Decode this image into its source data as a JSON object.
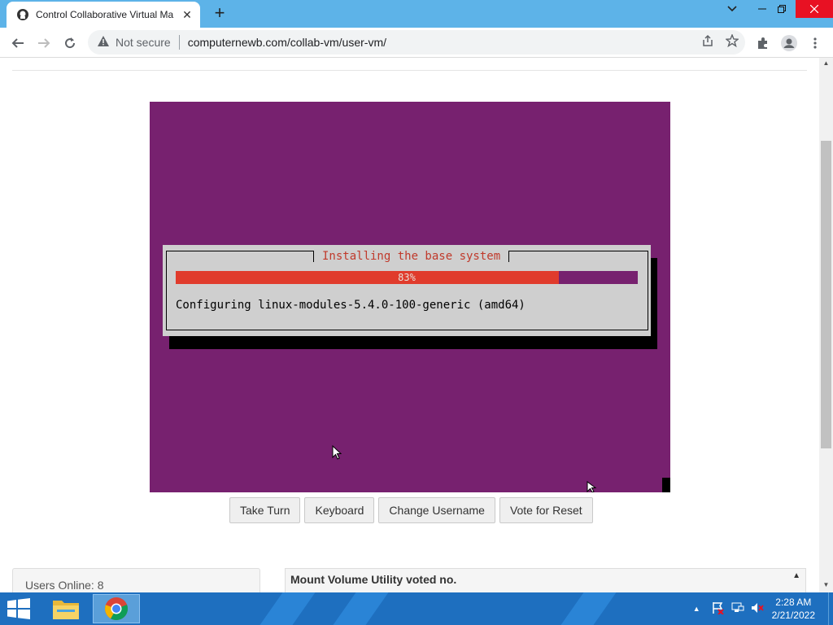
{
  "browser": {
    "tab_title": "Control Collaborative Virtual Ma",
    "tab_close": "✕",
    "new_tab": "+",
    "security_label": "Not secure",
    "url": "computernewb.com/collab-vm/user-vm/"
  },
  "vm": {
    "dialog_title": "Installing the base system",
    "progress_label": "83%",
    "progress_fraction": 0.83,
    "status_message": "Configuring linux-modules-5.4.0-100-generic (amd64)"
  },
  "controls": {
    "take_turn": "Take Turn",
    "keyboard": "Keyboard",
    "change_username": "Change Username",
    "vote_reset": "Vote for Reset"
  },
  "users_online": "Users Online: 8",
  "chat": {
    "last_message": "Mount Volume Utility voted no."
  },
  "taskbar": {
    "time": "2:28 AM",
    "date": "2/21/2022"
  },
  "colors": {
    "ubuntu_purple": "#77216f",
    "progress_red": "#e03b2c",
    "taskbar_blue": "#1e6fbf",
    "titlebar_blue": "#5db3e8"
  },
  "icons": [
    "back-arrow-icon",
    "forward-arrow-icon",
    "reload-icon",
    "warning-icon",
    "share-icon",
    "star-icon",
    "extensions-icon",
    "profile-icon",
    "menu-icon",
    "windows-start-icon",
    "file-explorer-icon",
    "chrome-icon"
  ]
}
